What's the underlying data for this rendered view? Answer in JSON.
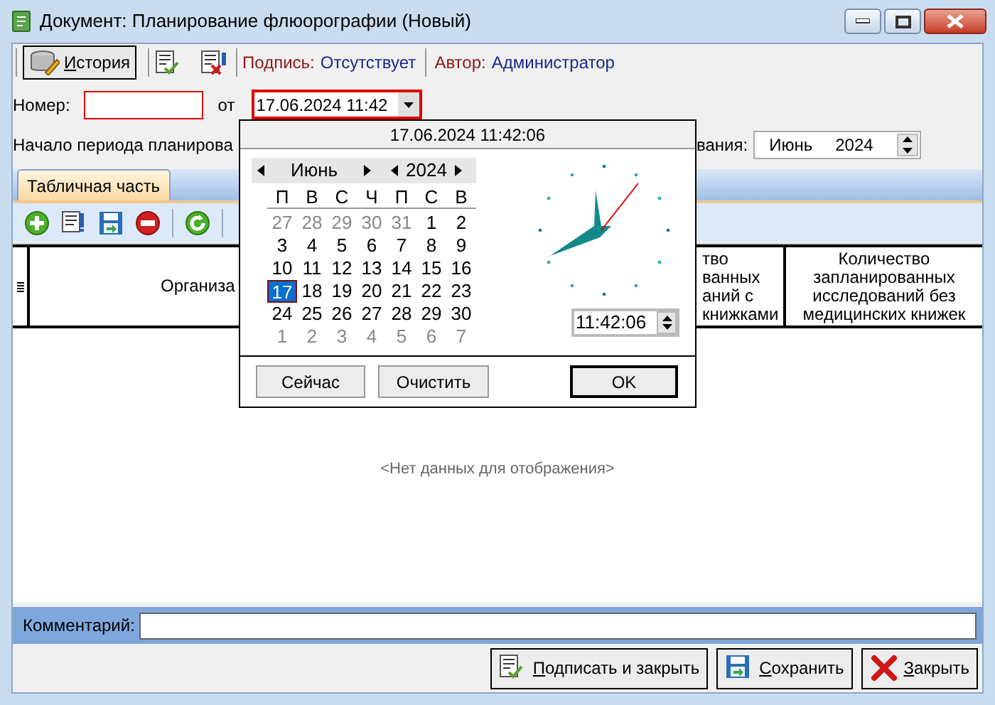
{
  "window": {
    "title": "Документ: Планирование флюорографии (Новый)"
  },
  "toolbar": {
    "history_button": "История",
    "signature_label": "Подпись:",
    "signature_value": "Отсутствует",
    "author_label": "Автор:",
    "author_value": "Администратор"
  },
  "header_fields": {
    "number_label": "Номер:",
    "date_label": "от",
    "date_value": "17.06.2024 11:42",
    "period_label_start": "Начало периода планирова",
    "period_label_end": "вания:",
    "period_month": "Июнь",
    "period_year": "2024"
  },
  "tabs": [
    {
      "label": "Табличная часть",
      "selected": true
    }
  ],
  "table": {
    "columns": [
      {
        "lines": [
          "Организа"
        ]
      },
      {
        "lines": [
          "тво",
          "ванных",
          "аний с",
          "книжками"
        ]
      },
      {
        "lines": [
          "Количество",
          "запланированных",
          "исследований без",
          "медицинских книжек"
        ]
      }
    ],
    "empty_text": "<Нет данных для отображения>"
  },
  "comment": {
    "label": "Комментарий:"
  },
  "buttons": [
    {
      "label": "Подписать и закрыть",
      "kind": "sign"
    },
    {
      "label": "Сохранить",
      "kind": "save"
    },
    {
      "label": "Закрыть",
      "kind": "close"
    }
  ],
  "date_popup": {
    "header": "17.06.2024 11:42:06",
    "month": "Июнь",
    "year": "2024",
    "weekdays": [
      "П",
      "В",
      "С",
      "Ч",
      "П",
      "С",
      "В"
    ],
    "weeks": [
      [
        {
          "label": "27",
          "muted": true,
          "selected": false
        },
        {
          "label": "28",
          "muted": true,
          "selected": false
        },
        {
          "label": "29",
          "muted": true,
          "selected": false
        },
        {
          "label": "30",
          "muted": true,
          "selected": false
        },
        {
          "label": "31",
          "muted": true,
          "selected": false
        },
        {
          "label": "1",
          "muted": false,
          "selected": false
        },
        {
          "label": "2",
          "muted": false,
          "selected": false
        }
      ],
      [
        {
          "label": "3",
          "muted": false,
          "selected": false
        },
        {
          "label": "4",
          "muted": false,
          "selected": false
        },
        {
          "label": "5",
          "muted": false,
          "selected": false
        },
        {
          "label": "6",
          "muted": false,
          "selected": false
        },
        {
          "label": "7",
          "muted": false,
          "selected": false
        },
        {
          "label": "8",
          "muted": false,
          "selected": false
        },
        {
          "label": "9",
          "muted": false,
          "selected": false
        }
      ],
      [
        {
          "label": "10",
          "muted": false,
          "selected": false
        },
        {
          "label": "11",
          "muted": false,
          "selected": false
        },
        {
          "label": "12",
          "muted": false,
          "selected": false
        },
        {
          "label": "13",
          "muted": false,
          "selected": false
        },
        {
          "label": "14",
          "muted": false,
          "selected": false
        },
        {
          "label": "15",
          "muted": false,
          "selected": false
        },
        {
          "label": "16",
          "muted": false,
          "selected": false
        }
      ],
      [
        {
          "label": "17",
          "muted": false,
          "selected": true
        },
        {
          "label": "18",
          "muted": false,
          "selected": false
        },
        {
          "label": "19",
          "muted": false,
          "selected": false
        },
        {
          "label": "20",
          "muted": false,
          "selected": false
        },
        {
          "label": "21",
          "muted": false,
          "selected": false
        },
        {
          "label": "22",
          "muted": false,
          "selected": false
        },
        {
          "label": "23",
          "muted": false,
          "selected": false
        }
      ],
      [
        {
          "label": "24",
          "muted": false,
          "selected": false
        },
        {
          "label": "25",
          "muted": false,
          "selected": false
        },
        {
          "label": "26",
          "muted": false,
          "selected": false
        },
        {
          "label": "27",
          "muted": false,
          "selected": false
        },
        {
          "label": "28",
          "muted": false,
          "selected": false
        },
        {
          "label": "29",
          "muted": false,
          "selected": false
        },
        {
          "label": "30",
          "muted": false,
          "selected": false
        }
      ],
      [
        {
          "label": "1",
          "muted": true,
          "selected": false
        },
        {
          "label": "2",
          "muted": true,
          "selected": false
        },
        {
          "label": "3",
          "muted": true,
          "selected": false
        },
        {
          "label": "4",
          "muted": true,
          "selected": false
        },
        {
          "label": "5",
          "muted": true,
          "selected": false
        },
        {
          "label": "6",
          "muted": true,
          "selected": false
        },
        {
          "label": "7",
          "muted": true,
          "selected": false
        }
      ]
    ],
    "time": "11:42:06",
    "buttons": [
      "Сейчас",
      "Очистить",
      "OK"
    ]
  }
}
